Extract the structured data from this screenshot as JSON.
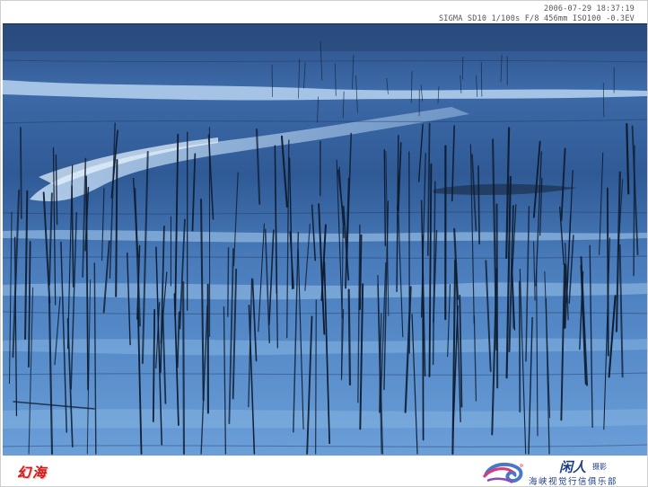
{
  "exif": {
    "datetime": "2006-07-29  18:37:19",
    "camera_settings": "SIGMA  SD10  1/100s  F/8  456mm  ISO100  -0.3EV"
  },
  "footer": {
    "caption": "幻海",
    "brand": "闲人",
    "brand_suffix": "摄影",
    "club": "海峡视觉行信俱乐部"
  },
  "colors": {
    "water_deep": "#1f3f74",
    "water_mid": "#3a6aa6",
    "water_light": "#9cc6ec",
    "reed": "#0e1c30",
    "caption_red": "#d11a1a",
    "brand_blue": "#1c3e86"
  }
}
